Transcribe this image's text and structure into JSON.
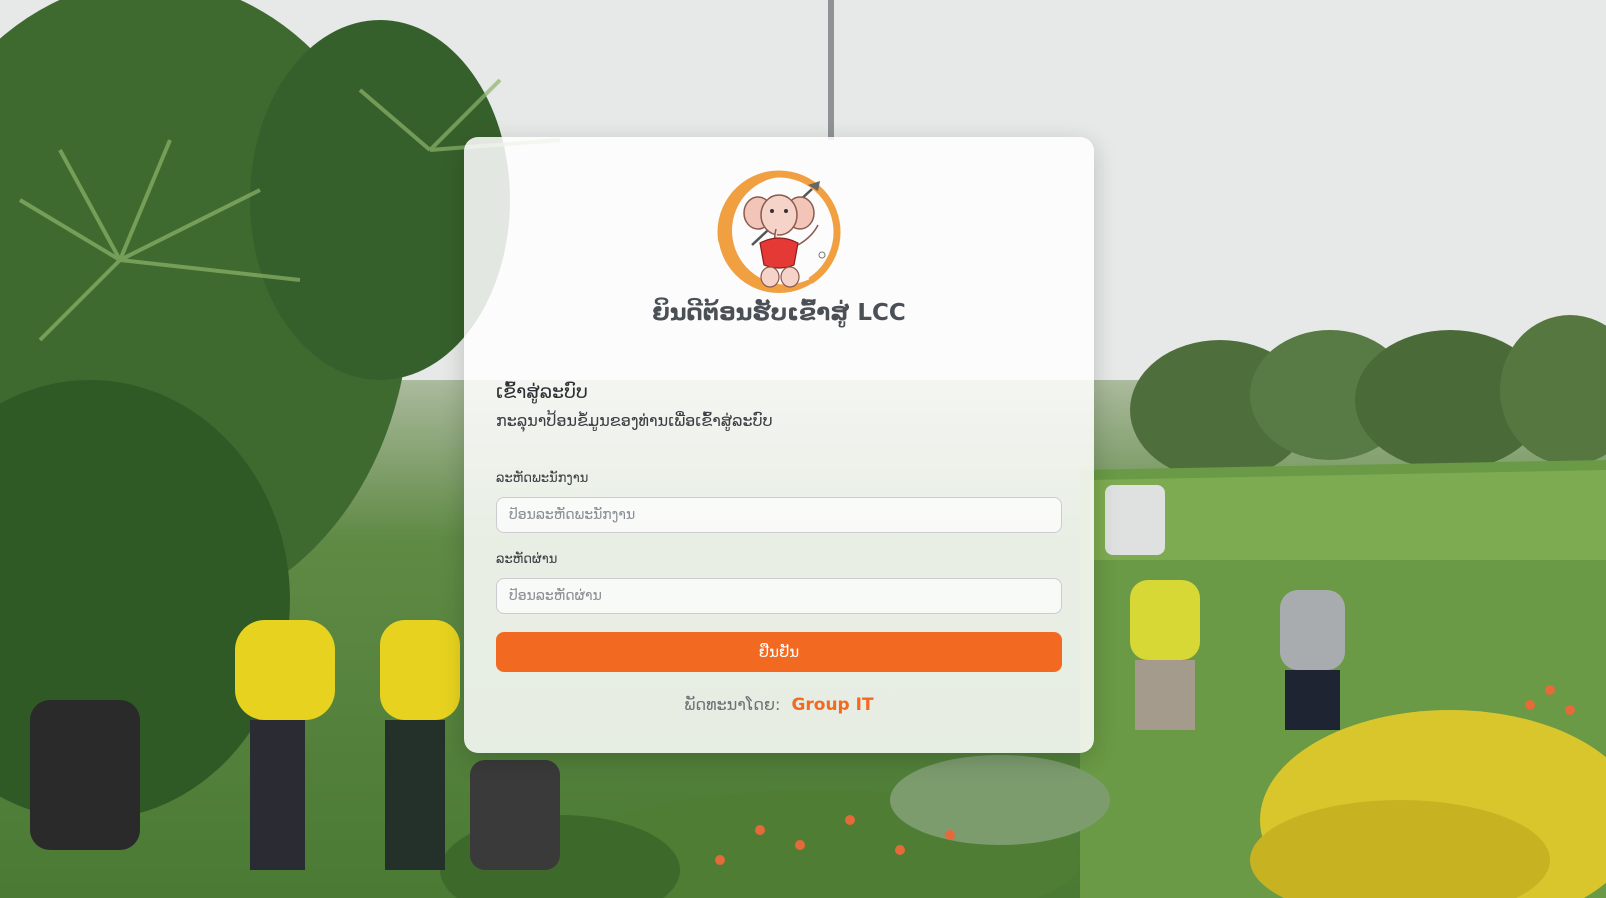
{
  "header": {
    "welcome_prefix": "ຍິນດີຕ້ອນຮັບເຂົ້າສູ່",
    "welcome_brand": "LCC"
  },
  "login": {
    "title": "ເຂົ້າສູ່ລະບົບ",
    "subtitle": "ກະລຸນາປ້ອນຂໍ້ມູນຂອງທ່ານເພື່ອເຂົ້າສູ່ລະບົບ",
    "employee_id_label": "ລະຫັດພະນັກງານ",
    "employee_id_placeholder": "ປ້ອນລະຫັດພະນັກງານ",
    "employee_id_value": "",
    "password_label": "ລະຫັດຜ່ານ",
    "password_placeholder": "ປ້ອນລະຫັດຜ່ານ",
    "password_value": "",
    "submit_label": "ຢືນຢັນ"
  },
  "footer": {
    "developed_by": "ພັດທະນາໂດຍ:",
    "team": "Group IT"
  },
  "colors": {
    "accent": "#f26a22",
    "logo_ring": "#f0a040",
    "text_dark": "#4b4f56"
  },
  "icons": {
    "logo": "elephant-golfer-logo"
  }
}
